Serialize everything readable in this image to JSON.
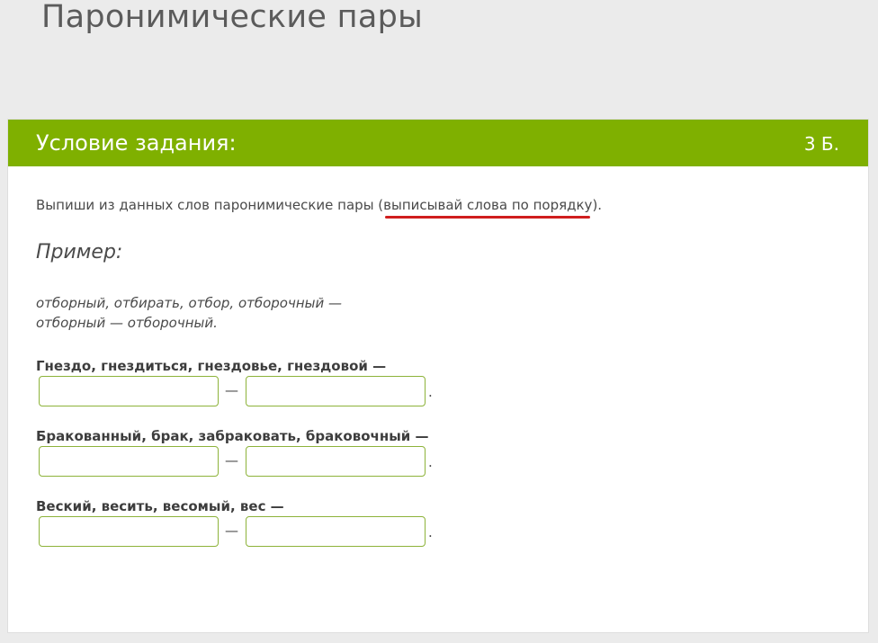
{
  "page": {
    "title": "Паронимические пары"
  },
  "card": {
    "title": "Условие задания:",
    "points": "3 Б."
  },
  "instruction": {
    "text_before": "Выпиши из данных слов паронимические пары (",
    "underlined": "выписывай слова по порядку",
    "text_after": ")."
  },
  "example": {
    "heading": "Пример:",
    "line1": "отборный, отбирать, отбор, отборочный —",
    "line2": "отборный — отборочный."
  },
  "tasks": [
    {
      "prompt": "Гнездо, гнездиться, гнездовье, гнездовой —",
      "answer1": "",
      "answer2": "",
      "separator": "—",
      "end": "."
    },
    {
      "prompt": "Бракованный, брак, забраковать, браковочный —",
      "answer1": "",
      "answer2": "",
      "separator": "—",
      "end": "."
    },
    {
      "prompt": "Веский, весить, весомый, вес —",
      "answer1": "",
      "answer2": "",
      "separator": "—",
      "end": "."
    }
  ],
  "colors": {
    "header_green": "#7fb000",
    "input_border": "#8db33a",
    "underline_red": "#d01e1e",
    "background": "#ebebeb"
  }
}
